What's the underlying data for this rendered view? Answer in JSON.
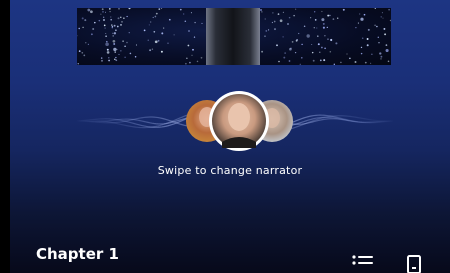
{
  "player": {
    "cover_icon": "starfield-cover-art",
    "narrator_selector": {
      "icons": [
        "narrator-avatar-left",
        "narrator-avatar-center",
        "narrator-avatar-right"
      ],
      "waveform_icon": "audio-waveform"
    },
    "hint_text": "Swipe to change narrator",
    "chapter_title": "Chapter 1",
    "controls": {
      "chapters_icon": "list-icon",
      "device_icon": "phone-icon"
    }
  },
  "colors": {
    "background_top": "#1d3583",
    "background_bottom": "#07091a",
    "text": "#ffffff",
    "avatar_ring": "#ffffff"
  }
}
